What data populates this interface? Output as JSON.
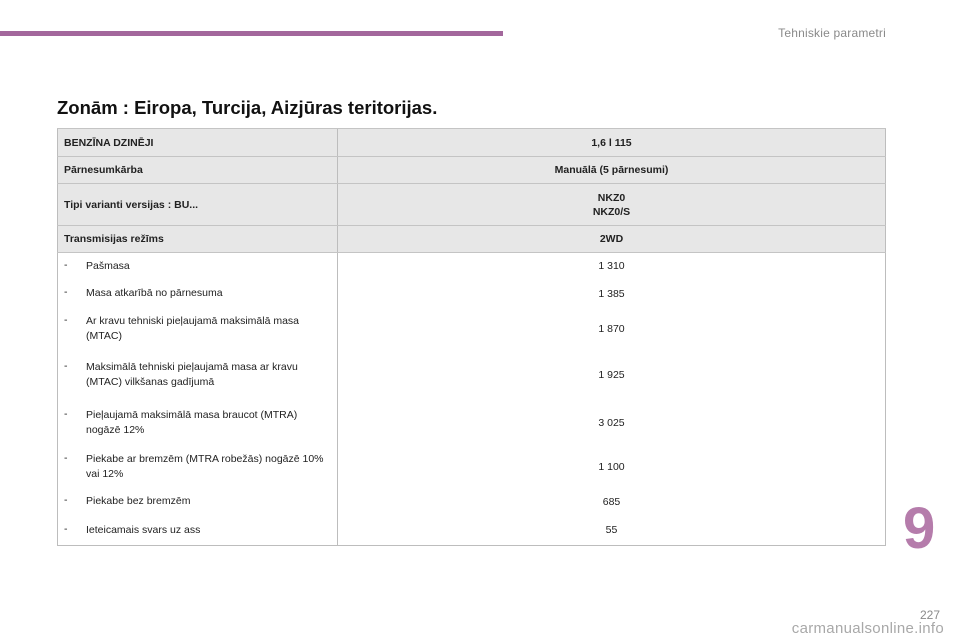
{
  "header": {
    "section_title": "Tehniskie parametri"
  },
  "title": "Zonām : Eiropa, Turcija, Aizjūras teritorijas.",
  "table": {
    "header_rows": [
      {
        "label": "BENZĪNA DZINĒJI",
        "value": "1,6 l 115"
      },
      {
        "label": "Pārnesumkārba",
        "value": "Manuālā (5 pārnesumi)"
      },
      {
        "label": "Tipi varianti versijas : BU...",
        "value": "NKZ0\nNKZ0/S"
      },
      {
        "label": "Transmisijas režīms",
        "value": "2WD"
      }
    ],
    "rows": [
      {
        "dash": "-",
        "label": "Pašmasa",
        "value": "1 310"
      },
      {
        "dash": "-",
        "label": "Masa atkarībā no pārnesuma",
        "value": "1 385"
      },
      {
        "dash": "-",
        "label": "Ar kravu tehniski pieļaujamā maksimālā masa (MTAC)",
        "value": "1 870"
      },
      {
        "dash": "-",
        "label": "Maksimālā tehniski pieļaujamā masa ar kravu (MTAC) vilkšanas gadījumā",
        "value": "1 925"
      },
      {
        "dash": "-",
        "label": "Pieļaujamā maksimālā masa braucot (MTRA) nogāzē 12%",
        "value": "3 025"
      },
      {
        "dash": "-",
        "label": "Piekabe ar bremzēm (MTRA robežās) nogāzē 10% vai 12%",
        "value": "1 100"
      },
      {
        "dash": "-",
        "label": "Piekabe bez bremzēm",
        "value": "685"
      },
      {
        "dash": "-",
        "label": "Ieteicamais svars uz ass",
        "value": "55"
      }
    ]
  },
  "chapter_number": "9",
  "page_number": "227",
  "watermark": "carmanualsonline.info",
  "colors": {
    "accent": "#a3679c",
    "chapter": "#b57cab",
    "header_bg": "#e7e7e7"
  }
}
